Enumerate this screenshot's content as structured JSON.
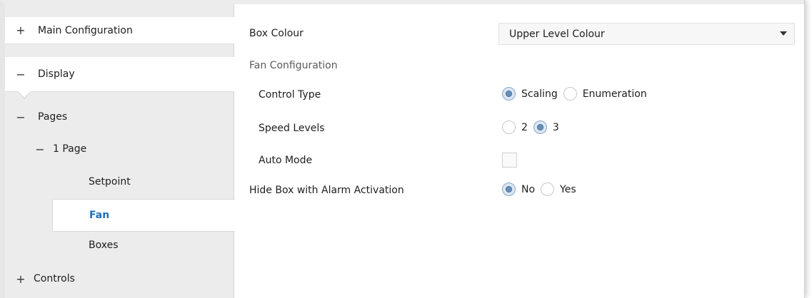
{
  "sidebar": {
    "items": [
      {
        "expander": "+",
        "label": "Main Configuration"
      },
      {
        "expander": "−",
        "label": "Display"
      },
      {
        "expander": "−",
        "label": "Pages"
      },
      {
        "expander": "−",
        "label": "1 Page"
      },
      {
        "expander": "",
        "label": "Setpoint"
      },
      {
        "expander": "",
        "label": "Fan",
        "selected": true
      },
      {
        "expander": "",
        "label": "Boxes"
      },
      {
        "expander": "+",
        "label": "Controls"
      }
    ]
  },
  "main": {
    "box_colour": {
      "label": "Box Colour",
      "value": "Upper Level Colour"
    },
    "fan_section": "Fan Configuration",
    "control_type": {
      "label": "Control Type",
      "options": [
        "Scaling",
        "Enumeration"
      ],
      "selected": "Scaling"
    },
    "speed_levels": {
      "label": "Speed Levels",
      "options": [
        "2",
        "3"
      ],
      "selected": "3"
    },
    "auto_mode": {
      "label": "Auto Mode",
      "checked": false
    },
    "hide_box": {
      "label": "Hide Box with Alarm Activation",
      "options": [
        "No",
        "Yes"
      ],
      "selected": "No"
    }
  },
  "colors": {
    "accent": "#1d6fb8",
    "sidebar_bg": "#ececec",
    "radio_selected": "#6a8fb5"
  }
}
